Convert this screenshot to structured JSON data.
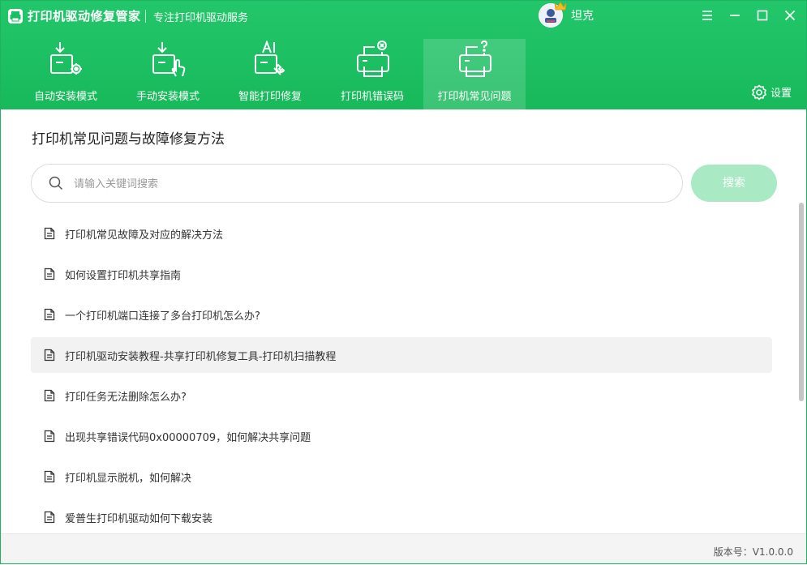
{
  "app": {
    "title": "打印机驱动修复管家",
    "subtitle": "专注打印机驱动服务"
  },
  "user": {
    "name": "坦克"
  },
  "nav": {
    "items": [
      {
        "label": "自动安装模式",
        "icon": "auto-install-icon"
      },
      {
        "label": "手动安装模式",
        "icon": "manual-install-icon"
      },
      {
        "label": "智能打印修复",
        "icon": "ai-repair-icon"
      },
      {
        "label": "打印机错误码",
        "icon": "printer-error-icon"
      },
      {
        "label": "打印机常见问题",
        "icon": "printer-faq-icon"
      }
    ],
    "active_index": 4,
    "settings_label": "设置"
  },
  "main": {
    "title": "打印机常见问题与故障修复方法",
    "search": {
      "placeholder": "请输入关键词搜索",
      "value": "",
      "button_label": "搜索"
    },
    "articles": [
      "打印机常见故障及对应的解决方法",
      "如何设置打印机共享指南",
      "一个打印机端口连接了多台打印机怎么办?",
      "打印机驱动安装教程-共享打印机修复工具-打印机扫描教程",
      "打印任务无法删除怎么办?",
      "出现共享错误代码0x00000709，如何解决共享问题",
      "打印机显示脱机，如何解决",
      "爱普生打印机驱动如何下载安装"
    ]
  },
  "footer": {
    "version": "版本号：V1.0.0.0"
  },
  "colors": {
    "brand": "#1cc064",
    "button_disabled": "#a9e9c3",
    "hover_row": "#f2f2f2"
  }
}
